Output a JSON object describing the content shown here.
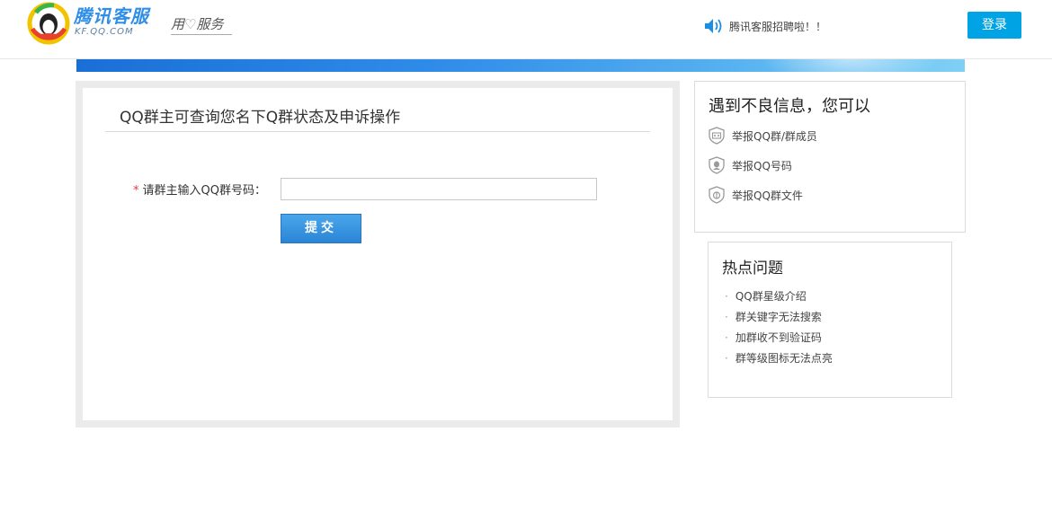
{
  "header": {
    "brand_title": "腾讯客服",
    "brand_sub": "KF.QQ.COM",
    "slogan_left": "用",
    "slogan_right": "服务",
    "notice": "腾讯客服招聘啦！！",
    "login_label": "登录"
  },
  "form": {
    "title": "QQ群主可查询您名下Q群状态及申诉操作",
    "required_mark": "*",
    "field_label": "请群主输入QQ群号码：",
    "input_value": "",
    "input_placeholder": "",
    "submit_label": "提交"
  },
  "report": {
    "title": "遇到不良信息，您可以",
    "items": [
      {
        "label": "举报QQ群/群成员",
        "icon": "group-report-icon"
      },
      {
        "label": "举报QQ号码",
        "icon": "user-report-icon"
      },
      {
        "label": "举报QQ群文件",
        "icon": "file-report-icon"
      }
    ]
  },
  "hot": {
    "title": "热点问题",
    "bullet": "·",
    "items": [
      {
        "label": "QQ群星级介绍"
      },
      {
        "label": "群关键字无法搜索"
      },
      {
        "label": "加群收不到验证码"
      },
      {
        "label": "群等级图标无法点亮"
      }
    ]
  },
  "colors": {
    "brand_blue": "#2f8ee6",
    "login_blue": "#00a4e4",
    "required_red": "#e4393c",
    "submit_blue": "#2a85d6"
  }
}
